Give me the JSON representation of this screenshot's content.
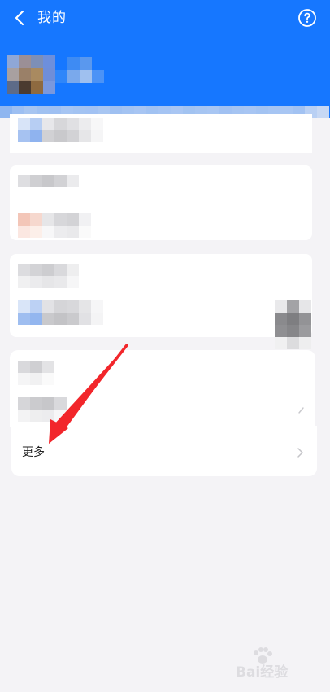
{
  "header": {
    "title": "我的",
    "back_icon": "chevron-left-icon",
    "help_icon": "question-circle-icon",
    "background_color": "#1677ff"
  },
  "list": {
    "more_label": "更多",
    "more_icon": "chevron-right-icon"
  },
  "annotation": {
    "arrow_color": "#f2262b"
  },
  "watermark": {
    "text": "Bai经验"
  }
}
